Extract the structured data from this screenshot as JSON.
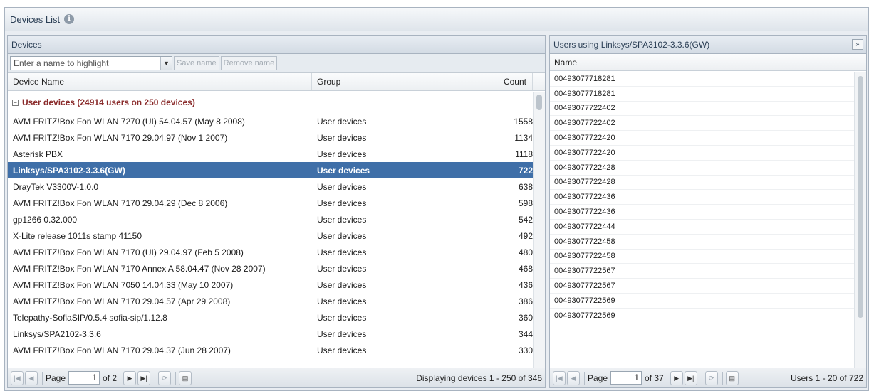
{
  "window": {
    "title": "Devices List",
    "info_icon": "i"
  },
  "devices_panel": {
    "title": "Devices",
    "highlight_combo": {
      "value": "Enter a name to highlight",
      "arrow": "▼"
    },
    "save_name_label": "Save name",
    "remove_name_label": "Remove name",
    "columns": {
      "name": "Device Name",
      "group": "Group",
      "count": "Count"
    },
    "group": {
      "toggle": "−",
      "label": "User devices (24914 users on 250 devices)"
    },
    "rows": [
      {
        "name": "AVM FRITZ!Box Fon WLAN 7270 (UI) 54.04.57 (May 8 2008)",
        "group": "User devices",
        "count": "1558"
      },
      {
        "name": "AVM FRITZ!Box Fon WLAN 7170 29.04.97 (Nov 1 2007)",
        "group": "User devices",
        "count": "1134"
      },
      {
        "name": "Asterisk PBX",
        "group": "User devices",
        "count": "1118"
      },
      {
        "name": "Linksys/SPA3102-3.3.6(GW)",
        "group": "User devices",
        "count": "722"
      },
      {
        "name": "DrayTek V3300V-1.0.0",
        "group": "User devices",
        "count": "638"
      },
      {
        "name": "AVM FRITZ!Box Fon WLAN 7170 29.04.29 (Dec 8 2006)",
        "group": "User devices",
        "count": "598"
      },
      {
        "name": "gp1266 0.32.000",
        "group": "User devices",
        "count": "542"
      },
      {
        "name": "X-Lite release 1011s stamp 41150",
        "group": "User devices",
        "count": "492"
      },
      {
        "name": "AVM FRITZ!Box Fon WLAN 7170 (UI) 29.04.97 (Feb 5 2008)",
        "group": "User devices",
        "count": "480"
      },
      {
        "name": "AVM FRITZ!Box Fon WLAN 7170 Annex A 58.04.47 (Nov 28 2007)",
        "group": "User devices",
        "count": "468"
      },
      {
        "name": "AVM FRITZ!Box Fon WLAN 7050 14.04.33 (May 10 2007)",
        "group": "User devices",
        "count": "436"
      },
      {
        "name": "AVM FRITZ!Box Fon WLAN 7170 29.04.57 (Apr 29 2008)",
        "group": "User devices",
        "count": "386"
      },
      {
        "name": "Telepathy-SofiaSIP/0.5.4 sofia-sip/1.12.8",
        "group": "User devices",
        "count": "360"
      },
      {
        "name": "Linksys/SPA2102-3.3.6",
        "group": "User devices",
        "count": "344"
      },
      {
        "name": "AVM FRITZ!Box Fon WLAN 7170 29.04.37 (Jun 28 2007)",
        "group": "User devices",
        "count": "330"
      }
    ],
    "selected_index": 3,
    "pager": {
      "first": "|◀",
      "prev": "◀",
      "page_label": "Page",
      "page_value": "1",
      "of_label": "of 2",
      "next": "▶",
      "last": "▶|",
      "refresh": "⟳",
      "export": "▤",
      "status": "Displaying devices 1 - 250 of 346"
    }
  },
  "users_panel": {
    "title": "Users using Linksys/SPA3102-3.3.6(GW)",
    "expand": "»",
    "column": "Name",
    "rows": [
      "00493077718281",
      "00493077718281",
      "00493077722402",
      "00493077722402",
      "00493077722420",
      "00493077722420",
      "00493077722428",
      "00493077722428",
      "00493077722436",
      "00493077722436",
      "00493077722444",
      "00493077722458",
      "00493077722458",
      "00493077722567",
      "00493077722567",
      "00493077722569",
      "00493077722569"
    ],
    "pager": {
      "first": "|◀",
      "prev": "◀",
      "page_label": "Page",
      "page_value": "1",
      "of_label": "of 37",
      "next": "▶",
      "last": "▶|",
      "refresh": "⟳",
      "export": "▤",
      "status": "Users 1 - 20 of 722"
    }
  },
  "colors": {
    "selected_row": "#3f6fa8",
    "group_text": "#8a2b2b",
    "header_text": "#2b3f55"
  }
}
